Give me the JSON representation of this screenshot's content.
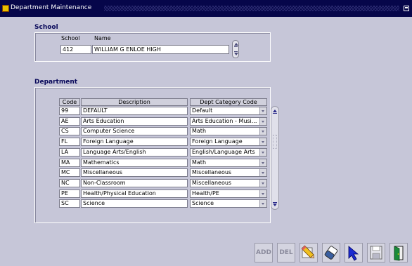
{
  "window": {
    "title": "Department Maintenance"
  },
  "school_section": {
    "label": "School",
    "school_caption": "School",
    "name_caption": "Name",
    "school_value": "412",
    "name_value": "WILLIAM G ENLOE HIGH"
  },
  "department_section": {
    "label": "Department",
    "columns": [
      "Code",
      "Description",
      "Dept Category Code"
    ],
    "rows": [
      {
        "code": "99",
        "description": "DEFAULT",
        "category": "Default"
      },
      {
        "code": "AE",
        "description": "Arts Education",
        "category": "Arts Education - Musi..."
      },
      {
        "code": "CS",
        "description": "Computer Science",
        "category": "Math"
      },
      {
        "code": "FL",
        "description": "Foreign Language",
        "category": "Foreign Language"
      },
      {
        "code": "LA",
        "description": "Language Arts/English",
        "category": "English/Language Arts"
      },
      {
        "code": "MA",
        "description": "Mathematics",
        "category": "Math"
      },
      {
        "code": "MC",
        "description": "Miscellaneous",
        "category": "Miscellaneous"
      },
      {
        "code": "NC",
        "description": "Non-Classroom",
        "category": "Miscellaneous"
      },
      {
        "code": "PE",
        "description": "Health/Physical Education",
        "category": "Health/PE"
      },
      {
        "code": "SC",
        "description": "Science",
        "category": "Science"
      }
    ]
  },
  "toolbar": {
    "add_label": "ADD",
    "del_label": "DEL",
    "edit_icon": "pencil-icon",
    "clear_icon": "eraser-icon",
    "select_icon": "pointer-icon",
    "save_icon": "floppy-disk-icon",
    "exit_icon": "exit-door-icon"
  },
  "colors": {
    "titlebar": "#06064a",
    "background": "#c6c6d8",
    "section_label": "#08085a"
  }
}
